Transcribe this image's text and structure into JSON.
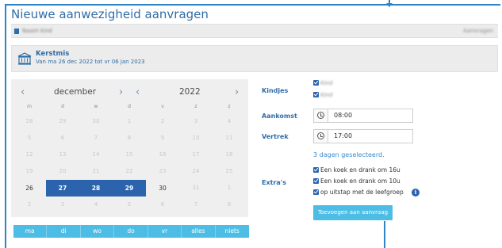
{
  "dialog": {
    "title": "Nieuwe aanwezigheid aanvragen"
  },
  "header": {
    "name": "Naam kind",
    "right": "Aanvragen"
  },
  "period": {
    "title": "Kerstmis",
    "subtitle": "Van ma 26 dec 2022 tot vr 06 jan 2023",
    "icon": "bank-building-icon"
  },
  "calendar": {
    "month": "december",
    "year": "2022",
    "prev": "‹",
    "next": "›",
    "weekdays": [
      "m",
      "d",
      "w",
      "d",
      "v",
      "z",
      "z"
    ],
    "weeks": [
      [
        "28",
        "29",
        "30",
        "1",
        "2",
        "3",
        "4"
      ],
      [
        "5",
        "6",
        "7",
        "8",
        "9",
        "10",
        "11"
      ],
      [
        "12",
        "13",
        "14",
        "15",
        "16",
        "17",
        "18"
      ],
      [
        "19",
        "20",
        "21",
        "22",
        "23",
        "24",
        "25"
      ],
      [
        "26",
        "27",
        "28",
        "29",
        "30",
        "31",
        "1"
      ],
      [
        "2",
        "3",
        "4",
        "5",
        "6",
        "7",
        "8"
      ]
    ],
    "selected_days": [
      "27",
      "28",
      "29"
    ]
  },
  "weekday_buttons": [
    "ma",
    "di",
    "wo",
    "do",
    "vr",
    "alles",
    "niets"
  ],
  "form": {
    "children_label": "Kindjes",
    "children": [
      "Kind",
      "Kind"
    ],
    "arrival_label": "Aankomst",
    "arrival_time": "08:00",
    "departure_label": "Vertrek",
    "departure_time": "17:00",
    "selected_summary": "3 dagen geselecteerd.",
    "extras_label": "Extra's",
    "extras": [
      "Een koek en drank om 16u",
      "Een koek en drank om 10u",
      "op uitstap met de leefgroep"
    ],
    "info": "i",
    "submit_label": "Toevoegen aan aanvraag"
  },
  "colors": {
    "primary": "#2b64ad",
    "accent": "#4dbde6",
    "title": "#2f6da6"
  }
}
